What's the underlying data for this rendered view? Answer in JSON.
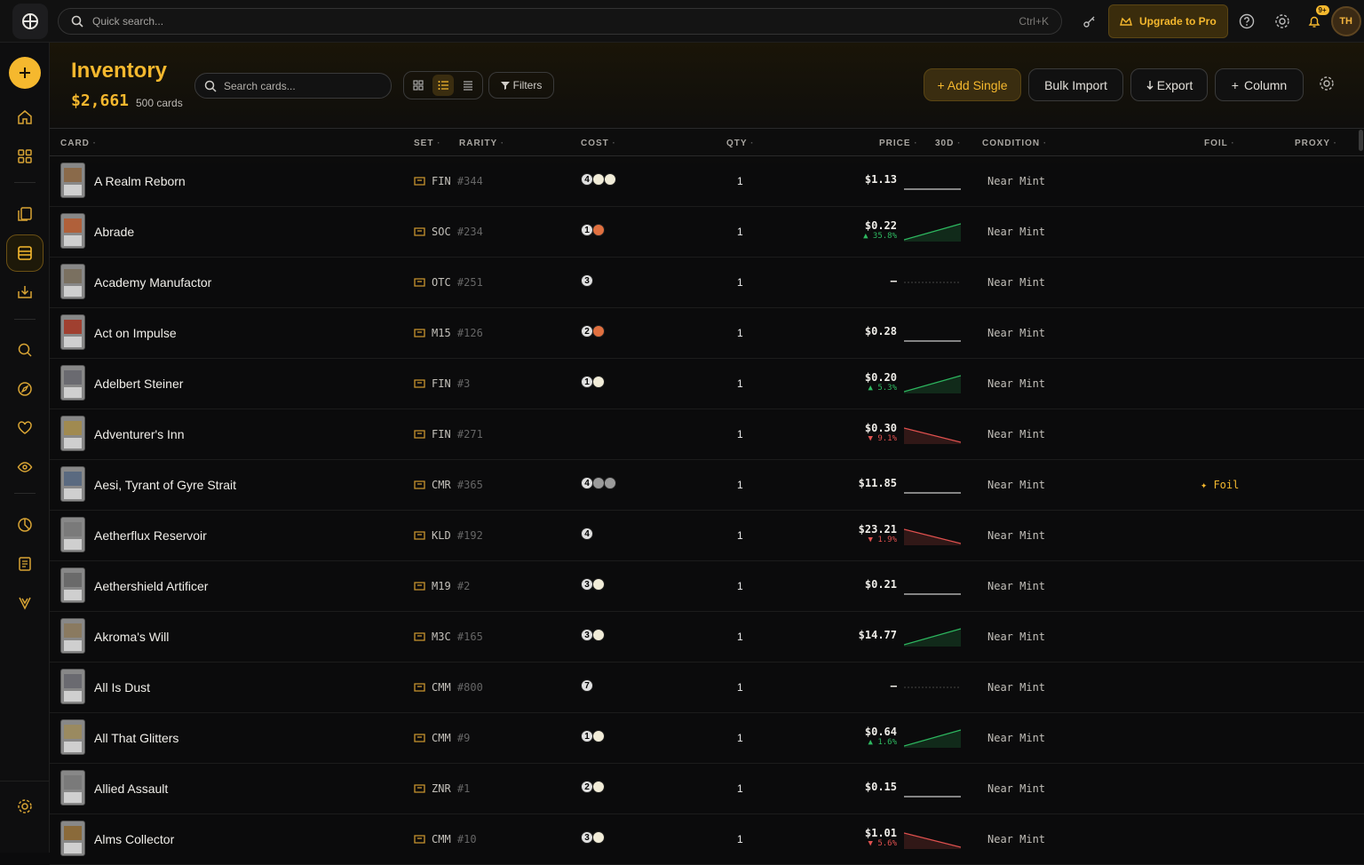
{
  "topbar": {
    "search_placeholder": "Quick search...",
    "shortcut": "Ctrl+K",
    "upgrade_label": "Upgrade to Pro",
    "notifications_badge": "9+",
    "avatar_initials": "TH"
  },
  "sidebar": {
    "icons": [
      "add-icon",
      "home-icon",
      "grid-icon",
      "collection-icon",
      "inventory-icon",
      "import-icon",
      "search-icon",
      "compass-icon",
      "heart-icon",
      "eye-icon",
      "chart-icon",
      "notebook-icon",
      "shield-icon",
      "gear-icon"
    ]
  },
  "header": {
    "title": "Inventory",
    "total_value": "$2,661",
    "card_count": "500 cards",
    "search_placeholder": "Search cards...",
    "filters_label": "Filters",
    "add_single_label": "+ Add Single",
    "bulk_import_label": "Bulk Import",
    "export_label": "Export",
    "column_label": "Column"
  },
  "table": {
    "columns": {
      "card": "CARD",
      "set": "SET",
      "rarity": "RARITY",
      "cost": "COST",
      "qty": "QTY",
      "price": "PRICE",
      "d30": "30D",
      "condition": "CONDITION",
      "foil": "FOIL",
      "proxy": "PROXY"
    },
    "rows": [
      {
        "name": "A Realm Reborn",
        "set": "FIN",
        "num": "#344",
        "cost": [
          "4",
          "W",
          "W"
        ],
        "qty": "1",
        "price": "$1.13",
        "delta": "",
        "trend": "flat",
        "condition": "Near Mint",
        "foil": ""
      },
      {
        "name": "Abrade",
        "set": "SOC",
        "num": "#234",
        "cost": [
          "1",
          "R"
        ],
        "qty": "1",
        "price": "$0.22",
        "delta": "▲ 35.8%",
        "trend": "up",
        "condition": "Near Mint",
        "foil": ""
      },
      {
        "name": "Academy Manufactor",
        "set": "OTC",
        "num": "#251",
        "cost": [
          "3"
        ],
        "qty": "1",
        "price": "—",
        "delta": "",
        "trend": "none",
        "condition": "Near Mint",
        "foil": ""
      },
      {
        "name": "Act on Impulse",
        "set": "M15",
        "num": "#126",
        "cost": [
          "2",
          "R"
        ],
        "qty": "1",
        "price": "$0.28",
        "delta": "",
        "trend": "flat",
        "condition": "Near Mint",
        "foil": ""
      },
      {
        "name": "Adelbert Steiner",
        "set": "FIN",
        "num": "#3",
        "cost": [
          "1",
          "W"
        ],
        "qty": "1",
        "price": "$0.20",
        "delta": "▲ 5.3%",
        "trend": "up",
        "condition": "Near Mint",
        "foil": ""
      },
      {
        "name": "Adventurer's Inn",
        "set": "FIN",
        "num": "#271",
        "cost": [],
        "qty": "1",
        "price": "$0.30",
        "delta": "▼ 9.1%",
        "trend": "down",
        "condition": "Near Mint",
        "foil": ""
      },
      {
        "name": "Aesi, Tyrant of Gyre Strait",
        "set": "CMR",
        "num": "#365",
        "cost": [
          "4",
          "G",
          "U"
        ],
        "qty": "1",
        "price": "$11.85",
        "delta": "",
        "trend": "flat",
        "condition": "Near Mint",
        "foil": "✦ Foil"
      },
      {
        "name": "Aetherflux Reservoir",
        "set": "KLD",
        "num": "#192",
        "cost": [
          "4"
        ],
        "qty": "1",
        "price": "$23.21",
        "delta": "▼ 1.9%",
        "trend": "down",
        "condition": "Near Mint",
        "foil": ""
      },
      {
        "name": "Aethershield Artificer",
        "set": "M19",
        "num": "#2",
        "cost": [
          "3",
          "W"
        ],
        "qty": "1",
        "price": "$0.21",
        "delta": "",
        "trend": "flat",
        "condition": "Near Mint",
        "foil": ""
      },
      {
        "name": "Akroma's Will",
        "set": "M3C",
        "num": "#165",
        "cost": [
          "3",
          "W"
        ],
        "qty": "1",
        "price": "$14.77",
        "delta": "",
        "trend": "up",
        "condition": "Near Mint",
        "foil": ""
      },
      {
        "name": "All Is Dust",
        "set": "CMM",
        "num": "#800",
        "cost": [
          "7"
        ],
        "qty": "1",
        "price": "—",
        "delta": "",
        "trend": "none",
        "condition": "Near Mint",
        "foil": ""
      },
      {
        "name": "All That Glitters",
        "set": "CMM",
        "num": "#9",
        "cost": [
          "1",
          "W"
        ],
        "qty": "1",
        "price": "$0.64",
        "delta": "▲ 1.6%",
        "trend": "up",
        "condition": "Near Mint",
        "foil": ""
      },
      {
        "name": "Allied Assault",
        "set": "ZNR",
        "num": "#1",
        "cost": [
          "2",
          "W"
        ],
        "qty": "1",
        "price": "$0.15",
        "delta": "",
        "trend": "flat",
        "condition": "Near Mint",
        "foil": ""
      },
      {
        "name": "Alms Collector",
        "set": "CMM",
        "num": "#10",
        "cost": [
          "3",
          "W"
        ],
        "qty": "1",
        "price": "$1.01",
        "delta": "▼ 5.6%",
        "trend": "down",
        "condition": "Near Mint",
        "foil": ""
      }
    ]
  },
  "colors": {
    "accent": "#f5b82e",
    "up": "#2eb860",
    "down": "#e0514f"
  }
}
